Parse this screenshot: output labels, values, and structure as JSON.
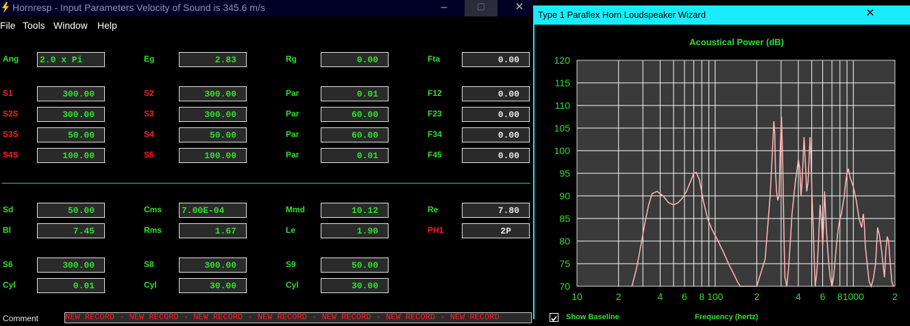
{
  "window": {
    "title": "Hornresp - Input Parameters   Velocity of Sound is 345.6 m/s",
    "controls": {
      "minimize": "–",
      "maximize": "□",
      "close": "✕"
    }
  },
  "menu": [
    "File",
    "Tools",
    "Window",
    "Help"
  ],
  "params": {
    "ang": {
      "label": "Ang",
      "value": "2.0 x Pi"
    },
    "eg": {
      "label": "Eg",
      "value": "2.83"
    },
    "rg": {
      "label": "Rg",
      "value": "0.00"
    },
    "fta": {
      "label": "Fta",
      "value": "0.00"
    },
    "s1": {
      "label": "S1",
      "value": "300.00"
    },
    "s2": {
      "label": "S2",
      "value": "300.00"
    },
    "par1": {
      "label": "Par",
      "value": "0.01"
    },
    "f12": {
      "label": "F12",
      "value": "0.00"
    },
    "s2s": {
      "label": "S2S",
      "value": "300.00"
    },
    "s3": {
      "label": "S3",
      "value": "300.00"
    },
    "par2": {
      "label": "Par",
      "value": "60.00"
    },
    "f23": {
      "label": "F23",
      "value": "0.00"
    },
    "s3s": {
      "label": "S3S",
      "value": "50.00"
    },
    "s4": {
      "label": "S4",
      "value": "50.00"
    },
    "par3": {
      "label": "Par",
      "value": "60.00"
    },
    "f34": {
      "label": "F34",
      "value": "0.00"
    },
    "s4s": {
      "label": "S4S",
      "value": "100.00"
    },
    "s5": {
      "label": "S5",
      "value": "100.00"
    },
    "par4": {
      "label": "Par",
      "value": "0.01"
    },
    "f45": {
      "label": "F45",
      "value": "0.00"
    },
    "sd": {
      "label": "Sd",
      "value": "50.00"
    },
    "cms": {
      "label": "Cms",
      "value": "7.00E-04"
    },
    "mmd": {
      "label": "Mmd",
      "value": "10.12"
    },
    "re": {
      "label": "Re",
      "value": "7.80"
    },
    "bl": {
      "label": "Bl",
      "value": "7.45"
    },
    "rms": {
      "label": "Rms",
      "value": "1.67"
    },
    "le": {
      "label": "Le",
      "value": "1.90"
    },
    "ph1": {
      "label": "PH1",
      "value": "2P"
    },
    "s6": {
      "label": "S6",
      "value": "300.00"
    },
    "s8": {
      "label": "S8",
      "value": "300.00"
    },
    "s9": {
      "label": "S9",
      "value": "50.00"
    },
    "cyl1": {
      "label": "Cyl",
      "value": "0.01"
    },
    "cyl2": {
      "label": "Cyl",
      "value": "30.00"
    },
    "cyl3": {
      "label": "Cyl",
      "value": "30.00"
    }
  },
  "comment": {
    "label": "Comment",
    "value": "NEW RECORD - NEW RECORD - NEW RECORD - NEW RECORD - NEW RECORD - NEW RECORD - NEW RECORD"
  },
  "wizard": {
    "title": "Type 1 Paraflex Horn Loudspeaker Wizard",
    "close": "✕",
    "show_baseline": "Show Baseline",
    "baseline_checked": true,
    "xaxis_label": "Frequency (hertz)"
  },
  "chart_data": {
    "type": "line",
    "title": "Acoustical Power (dB)",
    "xlabel": "Frequency (hertz)",
    "ylabel": "",
    "xscale": "log",
    "xlim": [
      10,
      2000
    ],
    "ylim": [
      70,
      120
    ],
    "yticks": [
      70,
      75,
      80,
      85,
      90,
      95,
      100,
      105,
      110,
      115,
      120
    ],
    "xtick_labels": [
      {
        "x": 10,
        "label": "10"
      },
      {
        "x": 20,
        "label": "2"
      },
      {
        "x": 40,
        "label": "4"
      },
      {
        "x": 60,
        "label": "6"
      },
      {
        "x": 80,
        "label": "8"
      },
      {
        "x": 100,
        "label": "100"
      },
      {
        "x": 200,
        "label": "2"
      },
      {
        "x": 400,
        "label": "4"
      },
      {
        "x": 600,
        "label": "6"
      },
      {
        "x": 800,
        "label": "8"
      },
      {
        "x": 1000,
        "label": "1000"
      },
      {
        "x": 2000,
        "label": "2"
      }
    ],
    "grid": true,
    "colors": {
      "title": "#2ee02e",
      "ticks": "#2ee02e",
      "plot_bg": "#3a3a3a",
      "grid": "#ffffff",
      "line": "#ffb3b3"
    },
    "series": [
      {
        "x": [
          25,
          27,
          29,
          31,
          33,
          35,
          38,
          42,
          46,
          50,
          54,
          58,
          62,
          66,
          68,
          70,
          73,
          77,
          82,
          88,
          95,
          105,
          115,
          125,
          135,
          145,
          152,
          200,
          230,
          250,
          260,
          266,
          270,
          273,
          278,
          284,
          290,
          295,
          302,
          308,
          312,
          316,
          320,
          330,
          340,
          350,
          360,
          380,
          400,
          410,
          418,
          425,
          432,
          440,
          450,
          460,
          470,
          478,
          486,
          494,
          500,
          508,
          516,
          524,
          530,
          540,
          550,
          560,
          575,
          590,
          600,
          610,
          620,
          640,
          660,
          680,
          700,
          720,
          740,
          760,
          780,
          800,
          820,
          840,
          860,
          880,
          900,
          920,
          950,
          1000,
          1050,
          1100,
          1150,
          1180,
          1200,
          1220,
          1250,
          1300,
          1350,
          1400,
          1450,
          1480,
          1500,
          1550,
          1600,
          1650,
          1680,
          1700,
          1720,
          1760,
          1800,
          1850,
          1900,
          1950
        ],
        "y": [
          70,
          74,
          79,
          84,
          88,
          90.5,
          91,
          90,
          88.5,
          88,
          88.5,
          89.5,
          91,
          93,
          94,
          95,
          95.2,
          93.5,
          89,
          85,
          82.5,
          80,
          77.5,
          75,
          73,
          71,
          70,
          70,
          76,
          90,
          100,
          106.5,
          104,
          96,
          91,
          89,
          90,
          99,
          107.5,
          98,
          88,
          79,
          72,
          70,
          74,
          80,
          86,
          93,
          98,
          96,
          90,
          93,
          97.5,
          103,
          97,
          91,
          93,
          98,
          103,
          99,
          92,
          86,
          80,
          74,
          70,
          72,
          75,
          80,
          88,
          84,
          79,
          84,
          91,
          82,
          76,
          72,
          70,
          72,
          76,
          80,
          83,
          85,
          86,
          88,
          90,
          93,
          95,
          96,
          94,
          92,
          89,
          85,
          83,
          86,
          84,
          79,
          76,
          71,
          70,
          72,
          75,
          80,
          83,
          81,
          78,
          74,
          72,
          75,
          78,
          81,
          80,
          75,
          71,
          70
        ]
      }
    ]
  }
}
